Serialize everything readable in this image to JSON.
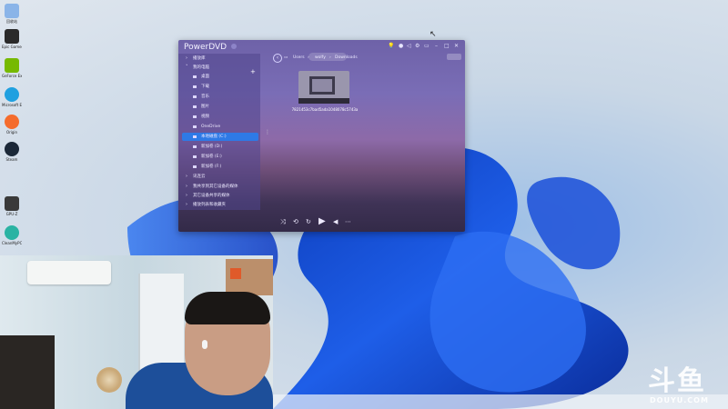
{
  "desktop": {
    "icons": [
      {
        "label": "回收站",
        "color": "#8ab4e8"
      },
      {
        "label": "Epic Games Launcher",
        "color": "#2a2a2a"
      },
      {
        "label": "GeForce Experience",
        "color": "#76b900"
      },
      {
        "label": "Microsoft Edge",
        "color": "#1fa0e0"
      },
      {
        "label": "Origin",
        "color": "#f56c2d"
      },
      {
        "label": "Steam",
        "color": "#1b2838"
      },
      {
        "label": "GPU-Z",
        "color": "#3a3a3a"
      },
      {
        "label": "CleanMyPC",
        "color": "#2ab3a3"
      }
    ]
  },
  "powerdvd": {
    "title": "PowerDVD",
    "controls": [
      "lightbulb-icon",
      "user-icon",
      "share-icon",
      "settings-icon",
      "monitor-icon",
      "minimize-icon",
      "maximize-icon",
      "close-icon"
    ],
    "sidebar": {
      "add_label": "+",
      "items": [
        {
          "label": "播放库",
          "arrow": "›",
          "icon": false,
          "selected": false
        },
        {
          "label": "我的电脑",
          "arrow": "˅",
          "icon": false,
          "selected": false
        },
        {
          "label": "桌面",
          "arrow": "",
          "icon": true,
          "selected": false
        },
        {
          "label": "下载",
          "arrow": "",
          "icon": true,
          "selected": false
        },
        {
          "label": "音乐",
          "arrow": "",
          "icon": true,
          "selected": false
        },
        {
          "label": "图片",
          "arrow": "",
          "icon": true,
          "selected": false
        },
        {
          "label": "视频",
          "arrow": "",
          "icon": true,
          "selected": false
        },
        {
          "label": "OneDrive",
          "arrow": "",
          "icon": true,
          "selected": false
        },
        {
          "label": "本地磁盘 (C:)",
          "arrow": "",
          "icon": true,
          "selected": true
        },
        {
          "label": "新加卷 (D:)",
          "arrow": "",
          "icon": true,
          "selected": false
        },
        {
          "label": "新加卷 (E:)",
          "arrow": "",
          "icon": true,
          "selected": false
        },
        {
          "label": "新加卷 (F:)",
          "arrow": "",
          "icon": true,
          "selected": false
        },
        {
          "label": "讯连云",
          "arrow": "›",
          "icon": false,
          "selected": false
        },
        {
          "label": "我共享到其它设备的媒体",
          "arrow": "›",
          "icon": false,
          "selected": false
        },
        {
          "label": "其它设备共享的媒体",
          "arrow": "›",
          "icon": false,
          "selected": false
        },
        {
          "label": "播放列表和收藏夹",
          "arrow": "›",
          "icon": false,
          "selected": false
        }
      ]
    },
    "breadcrumb": [
      "Users",
      "wolfy",
      "Downloads"
    ],
    "file": {
      "name": "7821453c7bad5ada1048078c5743a"
    },
    "player": [
      "shuffle-icon",
      "repeat-icon",
      "refresh-icon",
      "play-icon",
      "volume-icon",
      "more-icon"
    ]
  },
  "watermark": {
    "main": "斗鱼",
    "sub": "DOUYU.COM"
  }
}
